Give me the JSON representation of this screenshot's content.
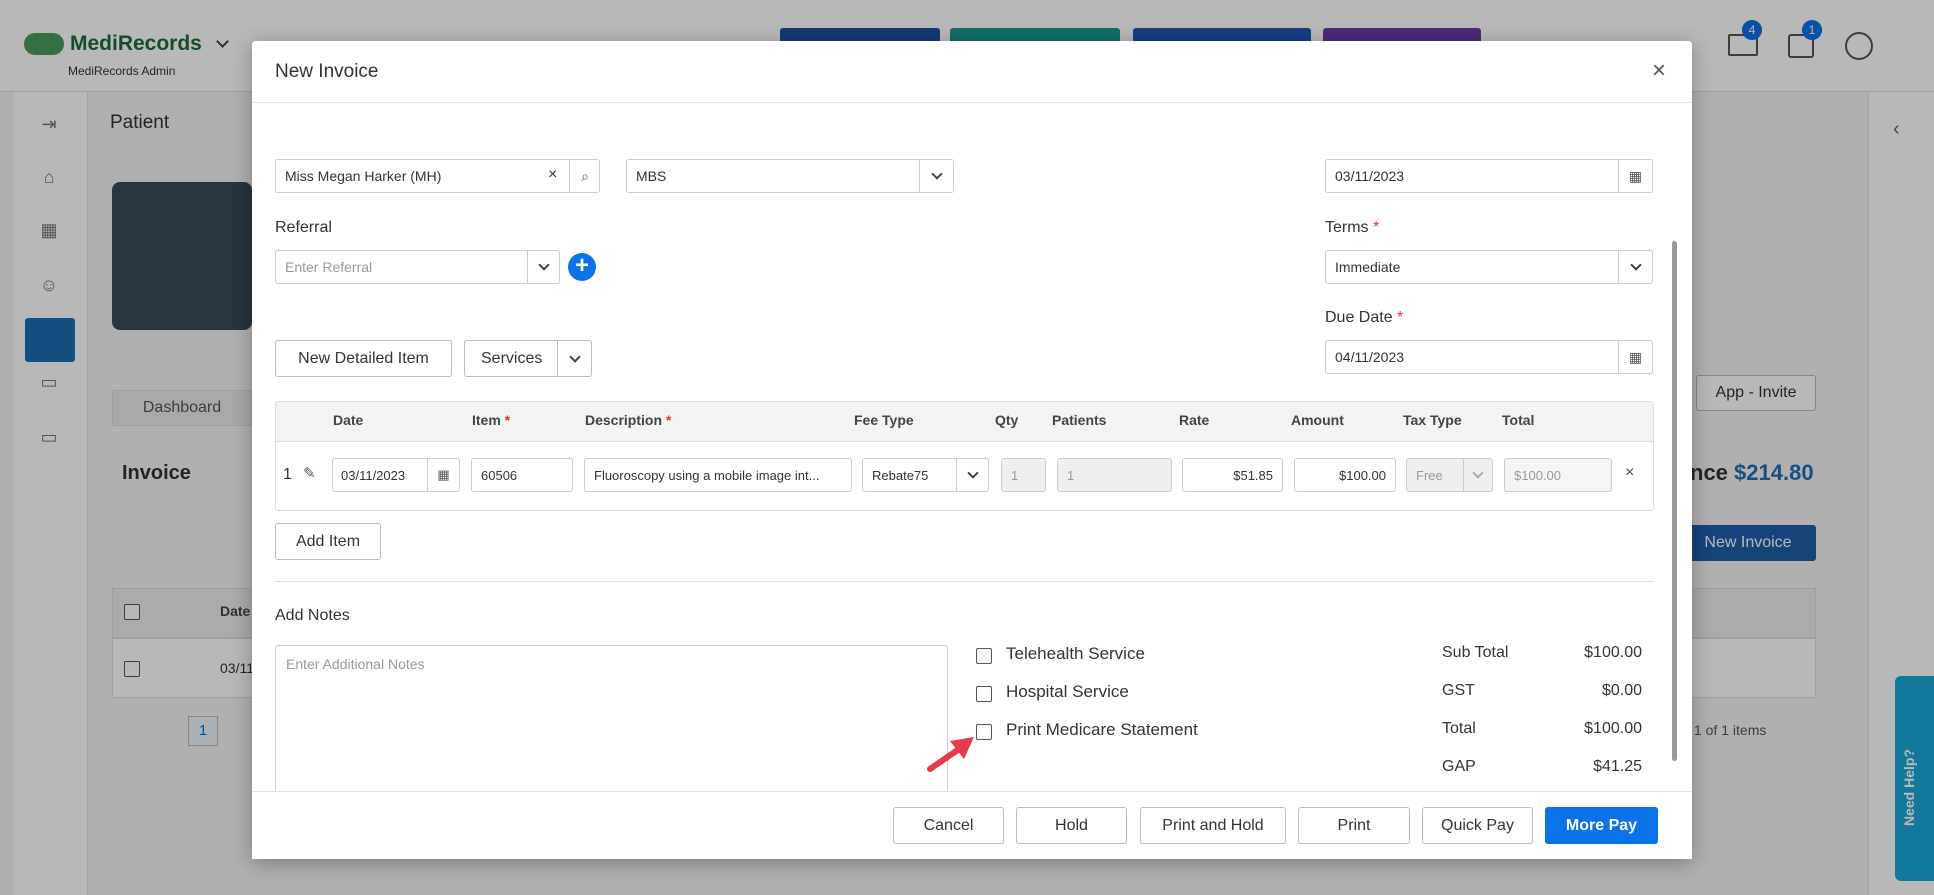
{
  "app": {
    "brand": "MediRecords",
    "brand_sub": "MediRecords Admin",
    "mail_badge": "4",
    "tasks_badge": "1"
  },
  "background": {
    "patient_label": "Patient",
    "dashboard_tab": "Dashboard",
    "invoice_heading": "Invoice",
    "balance_partial": "nce",
    "balance_value": "$214.80",
    "new_invoice_btn": "New Invoice",
    "app_invite_btn": "App - Invite",
    "date_col": "Date",
    "row_date": "03/11",
    "page_number": "1",
    "pager_text": "1 of 1 items",
    "need_help": "Need Help?"
  },
  "modal": {
    "title": "New Invoice",
    "close_glyph": "×",
    "patient_value": "Miss Megan Harker (MH)",
    "billing_type": "MBS",
    "invoice_date": "03/11/2023",
    "referral_label": "Referral",
    "referral_placeholder": "Enter Referral",
    "terms_label": "Terms",
    "terms_value": "Immediate",
    "due_date_label": "Due Date",
    "due_date_value": "04/11/2023",
    "new_detailed_item": "New Detailed Item",
    "services_label": "Services",
    "required_mark": "*",
    "table": {
      "headers": {
        "date": "Date",
        "item": "Item",
        "description": "Description",
        "fee_type": "Fee Type",
        "qty": "Qty",
        "patients": "Patients",
        "rate": "Rate",
        "amount": "Amount",
        "tax_type": "Tax Type",
        "total": "Total"
      },
      "row": {
        "index": "1",
        "date": "03/11/2023",
        "item": "60506",
        "description": "Fluoroscopy using a mobile image int...",
        "fee_type": "Rebate75",
        "qty": "1",
        "patients": "1",
        "rate": "$51.85",
        "amount": "$100.00",
        "tax_type": "Free",
        "total": "$100.00"
      }
    },
    "add_item": "Add Item",
    "add_notes_label": "Add Notes",
    "notes_placeholder": "Enter Additional Notes",
    "checkboxes": [
      {
        "label": "Telehealth Service"
      },
      {
        "label": "Hospital Service"
      },
      {
        "label": "Print Medicare Statement"
      }
    ],
    "summary": [
      {
        "label": "Sub Total",
        "value": "$100.00"
      },
      {
        "label": "GST",
        "value": "$0.00"
      },
      {
        "label": "Total",
        "value": "$100.00"
      },
      {
        "label": "GAP",
        "value": "$41.25"
      }
    ],
    "footer": {
      "cancel": "Cancel",
      "hold": "Hold",
      "print_and_hold": "Print and Hold",
      "print": "Print",
      "quick_pay": "Quick Pay",
      "more_pay": "More Pay"
    }
  },
  "colors": {
    "primary": "#0b72e7",
    "annotation_arrow": "#e8384a"
  }
}
